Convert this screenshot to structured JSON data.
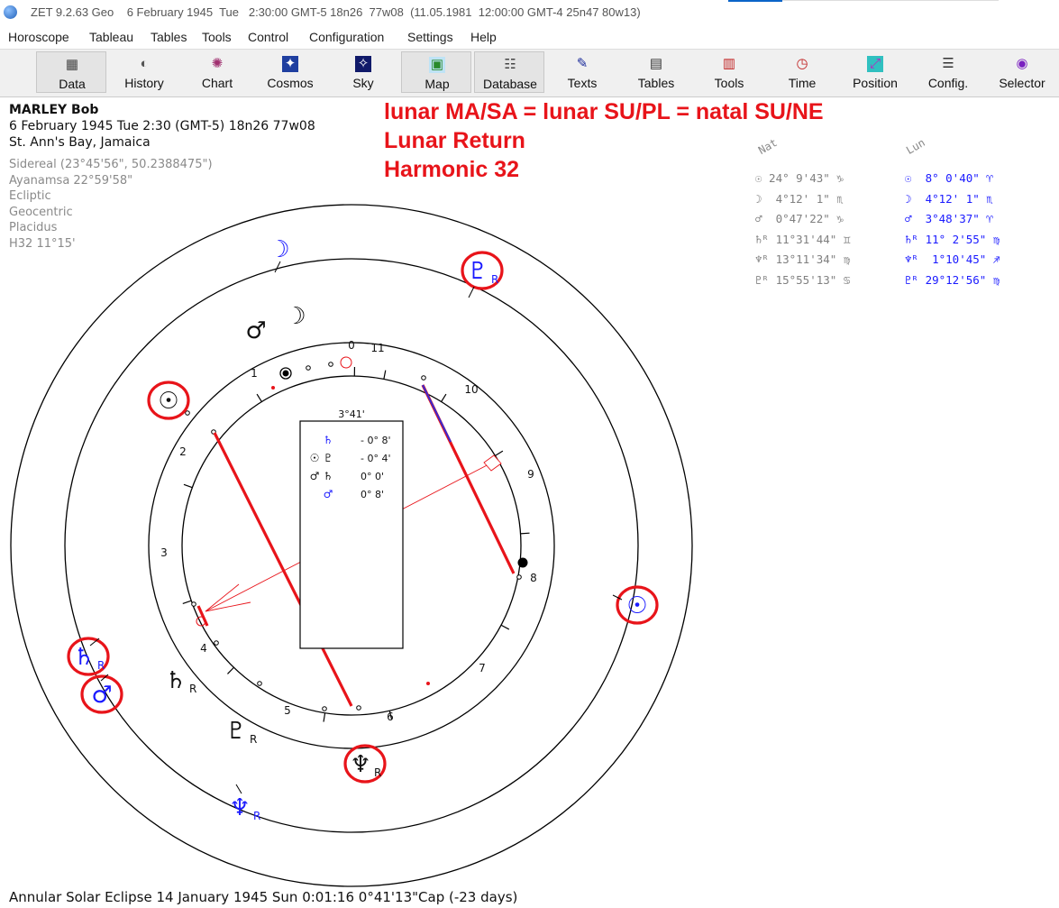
{
  "window": {
    "title": "ZET 9.2.63 Geo    6 February 1945  Tue   2:30:00 GMT-5 18n26  77w08  (11.05.1981  12:00:00 GMT-4 25n47 80w13)"
  },
  "menu": [
    "Horoscope",
    "Tableau",
    "Tables",
    "Tools",
    "Control",
    "Configuration",
    "Settings",
    "Help"
  ],
  "toolbar": [
    {
      "label": "Data",
      "icon": "data-grid-icon",
      "glyph": "▦"
    },
    {
      "label": "History",
      "icon": "history-icon",
      "glyph": "◐"
    },
    {
      "label": "Chart",
      "icon": "chart-wheel-icon",
      "glyph": "✺"
    },
    {
      "label": "Cosmos",
      "icon": "cosmos-icon",
      "glyph": "✦"
    },
    {
      "label": "Sky",
      "icon": "sky-icon",
      "glyph": "✧"
    },
    {
      "label": "Map",
      "icon": "map-icon",
      "glyph": "▣"
    },
    {
      "label": "Database",
      "icon": "database-icon",
      "glyph": "☷"
    },
    {
      "label": "Texts",
      "icon": "texts-icon",
      "glyph": "✎"
    },
    {
      "label": "Tables",
      "icon": "tables-icon",
      "glyph": "▤"
    },
    {
      "label": "Tools",
      "icon": "tools-icon",
      "glyph": "▥"
    },
    {
      "label": "Time",
      "icon": "time-icon",
      "glyph": "◷"
    },
    {
      "label": "Position",
      "icon": "position-icon",
      "glyph": "⤢"
    },
    {
      "label": "Config.",
      "icon": "config-icon",
      "glyph": "☰"
    },
    {
      "label": "Selector",
      "icon": "selector-icon",
      "glyph": "◉"
    }
  ],
  "person": {
    "name": "MARLEY Bob",
    "date_line": "6 February 1945  Tue   2:30 (GMT-5) 18n26  77w08",
    "place": "St. Ann's Bay, Jamaica",
    "settings": [
      "Sidereal (23°45'56\", 50.2388475\")",
      "Ayanamsa 22°59'58\"",
      "Ecliptic",
      "Geocentric",
      "Placidus",
      "H32  11°15'"
    ]
  },
  "annotation": [
    "lunar MA/SA = lunar SU/PL = natal SU/NE",
    "Lunar Return",
    "Harmonic 32"
  ],
  "positions": {
    "nat_header": "Nat",
    "lun_header": "Lun",
    "rows": [
      {
        "glyph": "☉",
        "nat": "24° 9'43\" ♑",
        "lun": " 8° 0'40\" ♈"
      },
      {
        "glyph": "☽",
        "nat": " 4°12' 1\" ♏",
        "lun": " 4°12' 1\" ♏"
      },
      {
        "glyph": "♂",
        "nat": " 0°47'22\" ♑",
        "lun": " 3°48'37\" ♈"
      },
      {
        "glyph": "♄ᴿ",
        "nat": "11°31'44\" ♊",
        "lun": "11° 2'55\" ♍"
      },
      {
        "glyph": "♆ᴿ",
        "nat": "13°11'34\" ♍",
        "lun": " 1°10'45\" ♐"
      },
      {
        "glyph": "♇ᴿ",
        "nat": "15°55'13\" ♋",
        "lun": "29°12'56\" ♍"
      }
    ]
  },
  "chart_center": {
    "orb_header": "3°41'",
    "aspects": [
      {
        "left": "",
        "glyph": "♄",
        "value": "- 0° 8'",
        "color": "#1a1aff"
      },
      {
        "left": "☉",
        "glyph": "♇",
        "value": "- 0° 4'",
        "color": "#111"
      },
      {
        "left": "♂",
        "glyph": "♄",
        "value": "0° 0'",
        "color": "#111"
      },
      {
        "left": "",
        "glyph": "♂",
        "value": "0° 8'",
        "color": "#1a1aff"
      }
    ]
  },
  "wheel": {
    "house_numbers": [
      "0",
      "11",
      "10",
      "9",
      "8",
      "7",
      "6",
      "5",
      "4",
      "3",
      "2",
      "1"
    ],
    "outer_planets": [
      {
        "glyph": "☽",
        "suffix": "",
        "color": "#1a1aff",
        "circled": false
      },
      {
        "glyph": "♇",
        "suffix": "R",
        "color": "#1a1aff",
        "circled": true
      },
      {
        "glyph": "☉",
        "suffix": "",
        "color": "#1a1aff",
        "circled": true
      },
      {
        "glyph": "♆",
        "suffix": "R",
        "color": "#1a1aff",
        "circled": false
      },
      {
        "glyph": "♂",
        "suffix": "",
        "color": "#1a1aff",
        "circled": true
      },
      {
        "glyph": "♄",
        "suffix": "R",
        "color": "#1a1aff",
        "circled": true
      }
    ],
    "middle_planets": [
      {
        "glyph": "♂",
        "suffix": "",
        "color": "#111",
        "circled": false
      },
      {
        "glyph": "☽",
        "suffix": "",
        "color": "#111",
        "circled": false
      },
      {
        "glyph": "☉",
        "suffix": "",
        "color": "#111",
        "circled": true
      },
      {
        "glyph": "♄",
        "suffix": "R",
        "color": "#111",
        "circled": false
      },
      {
        "glyph": "♇",
        "suffix": "R",
        "color": "#111",
        "circled": false
      },
      {
        "glyph": "♆",
        "suffix": "R",
        "color": "#111",
        "circled": true
      }
    ]
  },
  "footer": "Annular Solar Eclipse 14 January 1945 Sun  0:01:16  0°41'13\"Cap (-23 days)"
}
